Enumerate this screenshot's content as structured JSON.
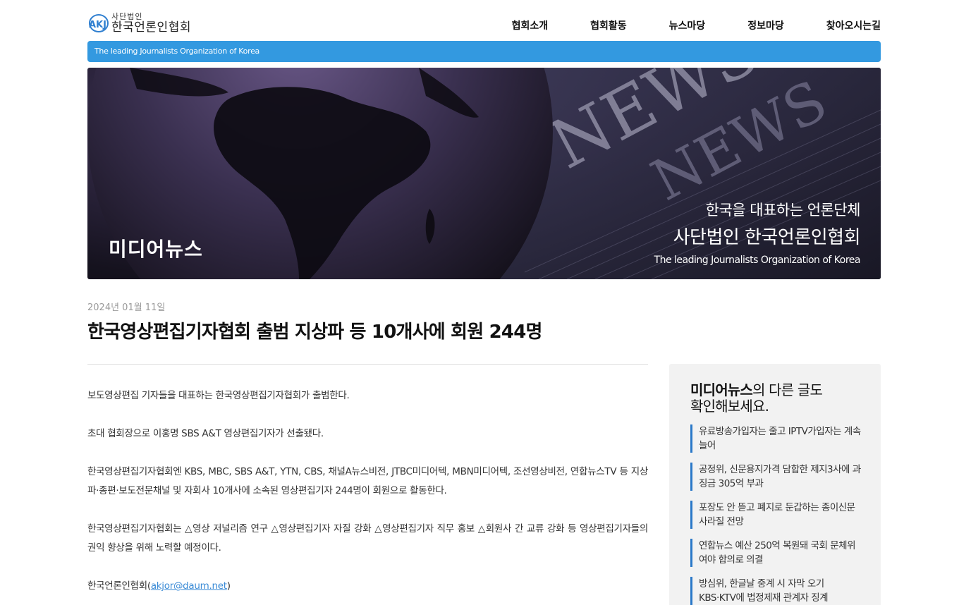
{
  "header": {
    "logo_mark": "AKJ",
    "logo_sub": "사단법인",
    "logo_main": "한국언론인협회",
    "nav": [
      "협회소개",
      "협회활동",
      "뉴스마당",
      "정보마당",
      "찾아오시는길"
    ]
  },
  "tagline": "The leading Journalists Organization of Korea",
  "banner": {
    "section_title": "미디어뉴스",
    "line1": "한국을 대표하는 언론단체",
    "line2": "사단법인 한국언론인협회",
    "line3": "The leading Journalists Organization of Korea",
    "decor_text": [
      "NEWS",
      "NEWS"
    ]
  },
  "article": {
    "date": "2024년 01월 11일",
    "title": "한국영상편집기자협회 출범 지상파 등 10개사에 회원 244명",
    "paragraphs": [
      "보도영상편집 기자들을 대표하는 한국영상편집기자협회가 출범한다.",
      "초대 협회장으로 이홍명 SBS A&T 영상편집기자가 선출됐다.",
      "한국영상편집기자협회엔 KBS, MBC, SBS A&T, YTN, CBS, 채널A뉴스비전, JTBC미디어텍, MBN미디어텍, 조선영상비전, 연합뉴스TV 등 지상파·종편·보도전문채널 및 자회사 10개사에 소속된 영상편집기자 244명이 회원으로 활동한다.",
      "한국영상편집기자협회는 △영상 저널리즘 연구 △영상편집기자 자질 강화 △영상편집기자 직무 홍보 △회원사 간 교류 강화 등 영상편집기자들의 권익 향상을 위해 노력할 예정이다."
    ],
    "source_prefix": "한국언론인협회(",
    "source_email": "akjor@daum.net",
    "source_suffix": ")"
  },
  "sidebar": {
    "heading_bold": "미디어뉴스",
    "heading_rest1": "의 다른 글도",
    "heading_rest2": "확인해보세요.",
    "items": [
      "유료방송가입자는 줄고 IPTV가입자는 계속 늘어",
      "공정위, 신문용지가격 담합한 제지3사에 과징금 305억 부과",
      "포장도 안 뜯고 폐지로 둔갑하는 종이신문 사라질 전망",
      "연합뉴스 예산 250억 복원돼 국회 문체위 여야 합의로 의결",
      "방심위, 한글날 중계 시 자막 오기 KBS·KTV에 법정제재 관계자 징계"
    ]
  },
  "colors": {
    "accent_blue": "#3399e0",
    "sidebar_border": "#2a78c8",
    "link": "#3b8bd6"
  }
}
